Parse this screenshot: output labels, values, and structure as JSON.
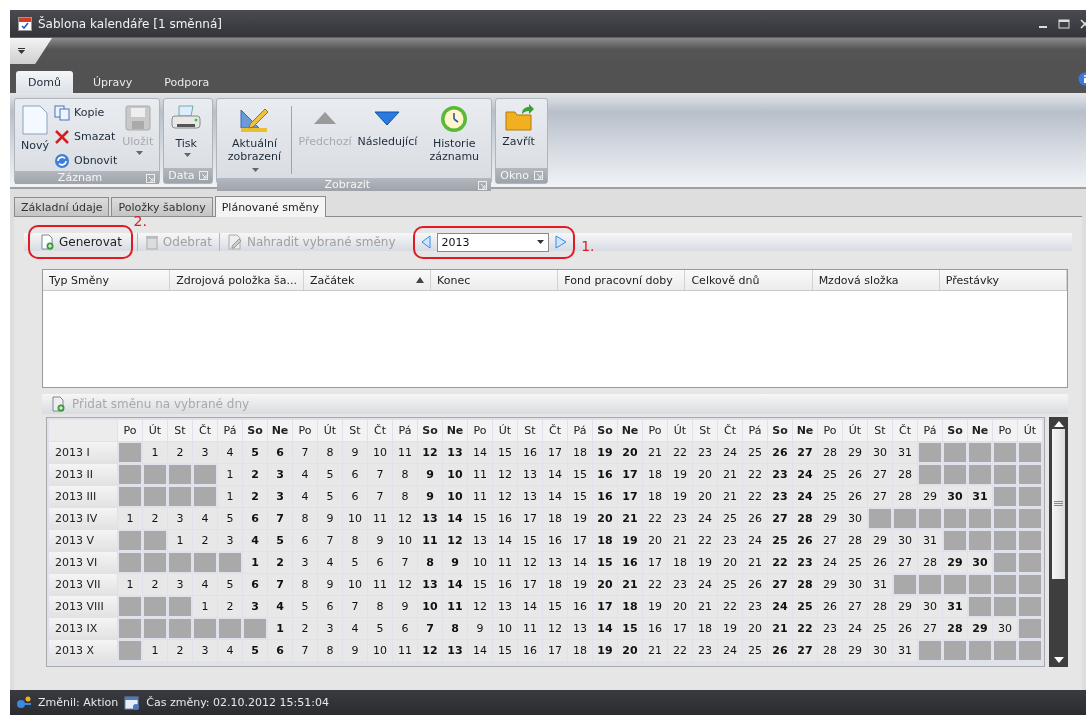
{
  "window": {
    "title": "Šablona kalendáře [1 směnná]"
  },
  "ribbon": {
    "tabs": [
      {
        "label": "Domů",
        "selected": true
      },
      {
        "label": "Úpravy",
        "selected": false
      },
      {
        "label": "Podpora",
        "selected": false
      }
    ],
    "groups": [
      {
        "title": "Záznam",
        "launcher": true,
        "buttons": [
          {
            "label": "Nový",
            "kind": "large",
            "disabled": false,
            "dropdown": false
          },
          {
            "label": "Kopie",
            "kind": "small",
            "disabled": false
          },
          {
            "label": "Smazat",
            "kind": "small",
            "disabled": false
          },
          {
            "label": "Obnovit",
            "kind": "small",
            "disabled": false
          },
          {
            "label": "Uložit",
            "kind": "large",
            "disabled": true,
            "dropdown": true
          }
        ]
      },
      {
        "title": "Data",
        "launcher": true,
        "buttons": [
          {
            "label": "Tisk",
            "kind": "large",
            "disabled": false,
            "dropdown": true
          }
        ]
      },
      {
        "title": "Zobrazit",
        "launcher": true,
        "buttons": [
          {
            "label": "Aktuální zobrazení",
            "kind": "large",
            "disabled": false,
            "dropdown": true
          },
          {
            "kind": "separator"
          },
          {
            "label": "Předchozí",
            "kind": "large",
            "disabled": true,
            "dropdown": false
          },
          {
            "label": "Následující",
            "kind": "large",
            "disabled": false,
            "dropdown": false
          },
          {
            "label": "Historie záznamu",
            "kind": "large",
            "disabled": false,
            "dropdown": false
          }
        ]
      },
      {
        "title": "Okno",
        "launcher": true,
        "buttons": [
          {
            "label": "Zavřít",
            "kind": "large",
            "disabled": false,
            "dropdown": false
          }
        ]
      }
    ]
  },
  "page_tabs": [
    {
      "label": "Základní údaje",
      "selected": false
    },
    {
      "label": "Položky šablony",
      "selected": false
    },
    {
      "label": "Plánované směny",
      "selected": true
    }
  ],
  "toolbar": {
    "buttons": [
      {
        "label": "Generovat",
        "disabled": false,
        "annotation": "2."
      },
      {
        "label": "Odebrat",
        "disabled": true
      },
      {
        "label": "Nahradit vybrané směny",
        "disabled": true
      }
    ],
    "year_selector": {
      "value": "2013",
      "annotation": "1."
    }
  },
  "table": {
    "columns": [
      {
        "label": "Typ Směny",
        "sorted": false
      },
      {
        "label": "Zdrojová položka ša...",
        "sorted": false
      },
      {
        "label": "Začátek",
        "sorted": true
      },
      {
        "label": "Konec",
        "sorted": false
      },
      {
        "label": "Fond pracovní doby",
        "sorted": false
      },
      {
        "label": "Celkově dnů",
        "sorted": false
      },
      {
        "label": "Mzdová složka",
        "sorted": false
      },
      {
        "label": "Přestávky",
        "sorted": false
      }
    ]
  },
  "add_shift_button": {
    "label": "Přidat směnu na vybrané dny",
    "disabled": true
  },
  "calendar": {
    "weekdays": [
      {
        "label": "Po",
        "weekend": false
      },
      {
        "label": "Út",
        "weekend": false
      },
      {
        "label": "St",
        "weekend": false
      },
      {
        "label": "Čt",
        "weekend": false
      },
      {
        "label": "Pá",
        "weekend": false
      },
      {
        "label": "So",
        "weekend": true
      },
      {
        "label": "Ne",
        "weekend": true
      },
      {
        "label": "Po",
        "weekend": false
      },
      {
        "label": "Út",
        "weekend": false
      },
      {
        "label": "St",
        "weekend": false
      },
      {
        "label": "Čt",
        "weekend": false
      },
      {
        "label": "Pá",
        "weekend": false
      },
      {
        "label": "So",
        "weekend": true
      },
      {
        "label": "Ne",
        "weekend": true
      },
      {
        "label": "Po",
        "weekend": false
      },
      {
        "label": "Út",
        "weekend": false
      },
      {
        "label": "St",
        "weekend": false
      },
      {
        "label": "Čt",
        "weekend": false
      },
      {
        "label": "Pá",
        "weekend": false
      },
      {
        "label": "So",
        "weekend": true
      },
      {
        "label": "Ne",
        "weekend": true
      },
      {
        "label": "Po",
        "weekend": false
      },
      {
        "label": "Út",
        "weekend": false
      },
      {
        "label": "St",
        "weekend": false
      },
      {
        "label": "Čt",
        "weekend": false
      },
      {
        "label": "Pá",
        "weekend": false
      },
      {
        "label": "So",
        "weekend": true
      },
      {
        "label": "Ne",
        "weekend": true
      },
      {
        "label": "Po",
        "weekend": false
      },
      {
        "label": "Út",
        "weekend": false
      },
      {
        "label": "St",
        "weekend": false
      },
      {
        "label": "Čt",
        "weekend": false
      },
      {
        "label": "Pá",
        "weekend": false
      },
      {
        "label": "So",
        "weekend": true
      },
      {
        "label": "Ne",
        "weekend": true
      },
      {
        "label": "Po",
        "weekend": false
      },
      {
        "label": "Út",
        "weekend": false
      }
    ],
    "months": [
      {
        "label": "2013 I",
        "leading": [
          {
            "kind": "blank"
          }
        ],
        "days": [
          "1",
          "2",
          "3",
          "4",
          "5",
          "6",
          "7",
          "8",
          "9",
          "10",
          "11",
          "12",
          "13",
          "14",
          "15",
          "16",
          "17",
          "18",
          "19",
          "20",
          "21",
          "22",
          "23",
          "24",
          "25",
          "26",
          "27",
          "28",
          "29",
          "30",
          "31"
        ],
        "trailing": [
          {
            "kind": "blank"
          },
          {
            "kind": "blank"
          },
          {
            "kind": "blank"
          },
          {
            "kind": "blank"
          },
          {
            "kind": "blank"
          }
        ]
      },
      {
        "label": "2013 II",
        "leading": [
          {
            "kind": "blank"
          },
          {
            "kind": "blank"
          },
          {
            "kind": "blank"
          },
          {
            "kind": "blank"
          }
        ],
        "days": [
          "1",
          "2",
          "3",
          "4",
          "5",
          "6",
          "7",
          "8",
          "9",
          "10",
          "11",
          "12",
          "13",
          "14",
          "15",
          "16",
          "17",
          "18",
          "19",
          "20",
          "21",
          "22",
          "23",
          "24",
          "25",
          "26",
          "27",
          "28"
        ],
        "trailing": [
          {
            "kind": "blank"
          },
          {
            "kind": "blank"
          },
          {
            "kind": "blank"
          },
          {
            "kind": "blank"
          },
          {
            "kind": "blank"
          }
        ]
      },
      {
        "label": "2013 III",
        "leading": [
          {
            "kind": "blank"
          },
          {
            "kind": "blank"
          },
          {
            "kind": "blank"
          },
          {
            "kind": "blank"
          }
        ],
        "days": [
          "1",
          "2",
          "3",
          "4",
          "5",
          "6",
          "7",
          "8",
          "9",
          "10",
          "11",
          "12",
          "13",
          "14",
          "15",
          "16",
          "17",
          "18",
          "19",
          "20",
          "21",
          "22",
          "23",
          "24",
          "25",
          "26",
          "27",
          "28",
          "29",
          "30",
          "31"
        ],
        "trailing": [
          {
            "kind": "blank"
          },
          {
            "kind": "blank"
          }
        ]
      },
      {
        "label": "2013 IV",
        "days": [
          "1",
          "2",
          "3",
          "4",
          "5",
          "6",
          "7",
          "8",
          "9",
          "10",
          "11",
          "12",
          "13",
          "14",
          "15",
          "16",
          "17",
          "18",
          "19",
          "20",
          "21",
          "22",
          "23",
          "24",
          "25",
          "26",
          "27",
          "28",
          "29",
          "30"
        ],
        "trailing": [
          {
            "kind": "blank"
          },
          {
            "kind": "blank"
          },
          {
            "kind": "blank"
          },
          {
            "kind": "blank"
          },
          {
            "kind": "blank"
          },
          {
            "kind": "blank"
          },
          {
            "kind": "blank"
          }
        ]
      },
      {
        "label": "2013 V",
        "leading": [
          {
            "kind": "blank"
          },
          {
            "kind": "blank"
          }
        ],
        "days": [
          "1",
          "2",
          "3",
          "4",
          "5",
          "6",
          "7",
          "8",
          "9",
          "10",
          "11",
          "12",
          "13",
          "14",
          "15",
          "16",
          "17",
          "18",
          "19",
          "20",
          "21",
          "22",
          "23",
          "24",
          "25",
          "26",
          "27",
          "28",
          "29",
          "30",
          "31"
        ],
        "trailing": [
          {
            "kind": "blank"
          },
          {
            "kind": "blank"
          },
          {
            "kind": "blank"
          },
          {
            "kind": "blank"
          }
        ]
      },
      {
        "label": "2013 VI",
        "leading": [
          {
            "kind": "blank"
          },
          {
            "kind": "blank"
          },
          {
            "kind": "blank"
          },
          {
            "kind": "blank"
          },
          {
            "kind": "blank"
          }
        ],
        "days": [
          "1",
          "2",
          "3",
          "4",
          "5",
          "6",
          "7",
          "8",
          "9",
          "10",
          "11",
          "12",
          "13",
          "14",
          "15",
          "16",
          "17",
          "18",
          "19",
          "20",
          "21",
          "22",
          "23",
          "24",
          "25",
          "26",
          "27",
          "28",
          "29",
          "30"
        ],
        "trailing": [
          {
            "kind": "blank"
          },
          {
            "kind": "blank"
          }
        ]
      },
      {
        "label": "2013 VII",
        "days": [
          "1",
          "2",
          "3",
          "4",
          "5",
          "6",
          "7",
          "8",
          "9",
          "10",
          "11",
          "12",
          "13",
          "14",
          "15",
          "16",
          "17",
          "18",
          "19",
          "20",
          "21",
          "22",
          "23",
          "24",
          "25",
          "26",
          "27",
          "28",
          "29",
          "30",
          "31"
        ],
        "trailing": [
          {
            "kind": "blank"
          },
          {
            "kind": "blank"
          },
          {
            "kind": "blank"
          },
          {
            "kind": "blank"
          },
          {
            "kind": "blank"
          },
          {
            "kind": "blank"
          }
        ]
      },
      {
        "label": "2013 VIII",
        "leading": [
          {
            "kind": "blank"
          },
          {
            "kind": "blank"
          },
          {
            "kind": "blank"
          }
        ],
        "days": [
          "1",
          "2",
          "3",
          "4",
          "5",
          "6",
          "7",
          "8",
          "9",
          "10",
          "11",
          "12",
          "13",
          "14",
          "15",
          "16",
          "17",
          "18",
          "19",
          "20",
          "21",
          "22",
          "23",
          "24",
          "25",
          "26",
          "27",
          "28",
          "29",
          "30",
          "31"
        ],
        "trailing": [
          {
            "kind": "blank"
          },
          {
            "kind": "blank"
          },
          {
            "kind": "blank"
          }
        ]
      },
      {
        "label": "2013 IX",
        "leading": [
          {
            "kind": "blank"
          },
          {
            "kind": "blank"
          },
          {
            "kind": "blank"
          },
          {
            "kind": "blank"
          },
          {
            "kind": "blank"
          },
          {
            "kind": "blank"
          }
        ],
        "days": [
          "1",
          "2",
          "3",
          "4",
          "5",
          "6",
          "7",
          "8",
          "9",
          "10",
          "11",
          "12",
          "13",
          "14",
          "15",
          "16",
          "17",
          "18",
          "19",
          "20",
          "21",
          "22",
          "23",
          "24",
          "25",
          "26",
          "27",
          "28",
          "29",
          "30"
        ],
        "trailing": [
          {
            "kind": "blank"
          }
        ]
      },
      {
        "label": "2013 X",
        "leading": [
          {
            "kind": "blank"
          }
        ],
        "days": [
          "1",
          "2",
          "3",
          "4",
          "5",
          "6",
          "7",
          "8",
          "9",
          "10",
          "11",
          "12",
          "13",
          "14",
          "15",
          "16",
          "17",
          "18",
          "19",
          "20",
          "21",
          "22",
          "23",
          "24",
          "25",
          "26",
          "27",
          "28",
          "29",
          "30",
          "31"
        ],
        "trailing": [
          {
            "kind": "blank"
          },
          {
            "kind": "blank"
          },
          {
            "kind": "blank"
          },
          {
            "kind": "blank"
          },
          {
            "kind": "blank"
          }
        ]
      }
    ]
  },
  "status_bar": {
    "changed_by": "Změnil: Aktion",
    "changed_at": "Čas změny: 02.10.2012 15:51:04"
  }
}
